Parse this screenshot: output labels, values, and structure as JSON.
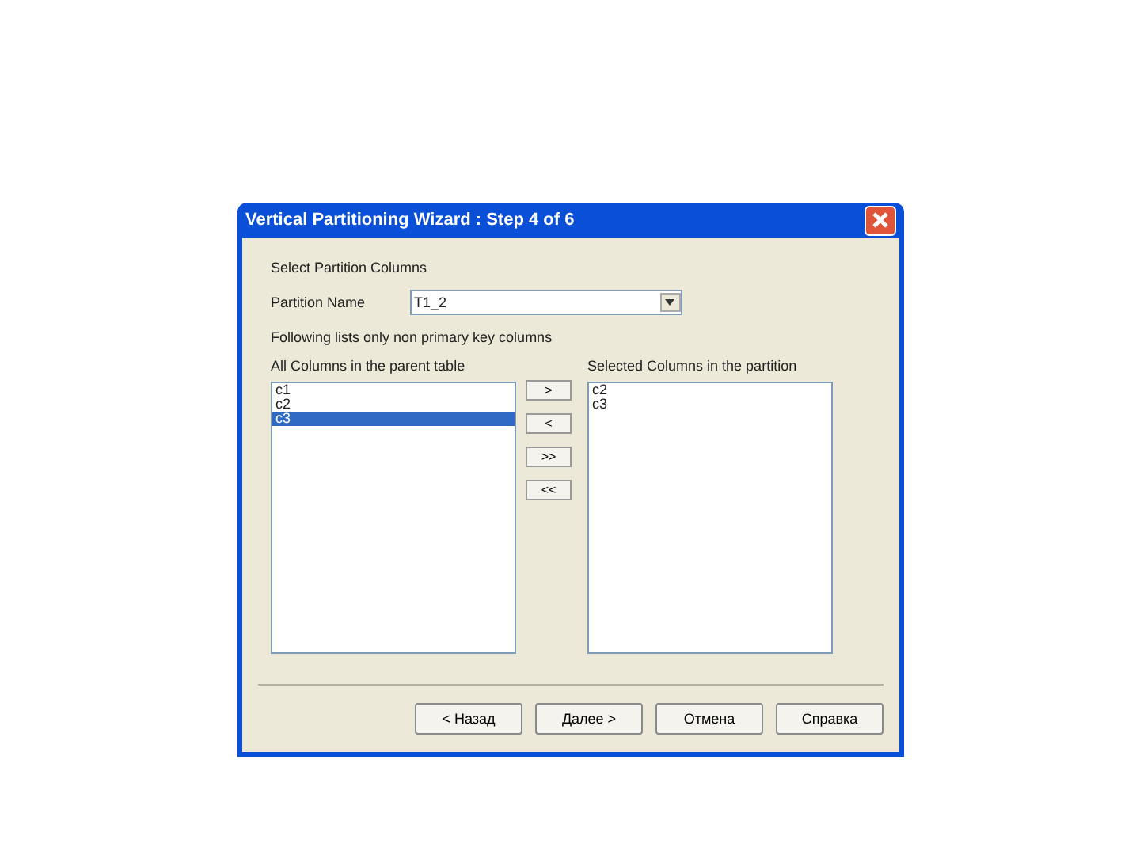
{
  "window": {
    "title": "Vertical Partitioning Wizard : Step 4 of 6"
  },
  "heading": "Select Partition Columns",
  "partition_name": {
    "label": "Partition Name",
    "value": "T1_2"
  },
  "note": "Following lists only non primary key columns",
  "parent_columns": {
    "label": "All Columns in the parent table",
    "items": [
      {
        "text": "c1",
        "selected": false
      },
      {
        "text": "c2",
        "selected": false
      },
      {
        "text": "c3",
        "selected": true
      }
    ]
  },
  "move_buttons": [
    ">",
    "<",
    ">>",
    "<<"
  ],
  "partition_columns": {
    "label": "Selected Columns in the partition",
    "items": [
      {
        "text": "c2",
        "selected": false
      },
      {
        "text": "c3",
        "selected": false
      }
    ]
  },
  "buttons": [
    "< Назад",
    "Далее >",
    "Отмена",
    "Справка"
  ]
}
